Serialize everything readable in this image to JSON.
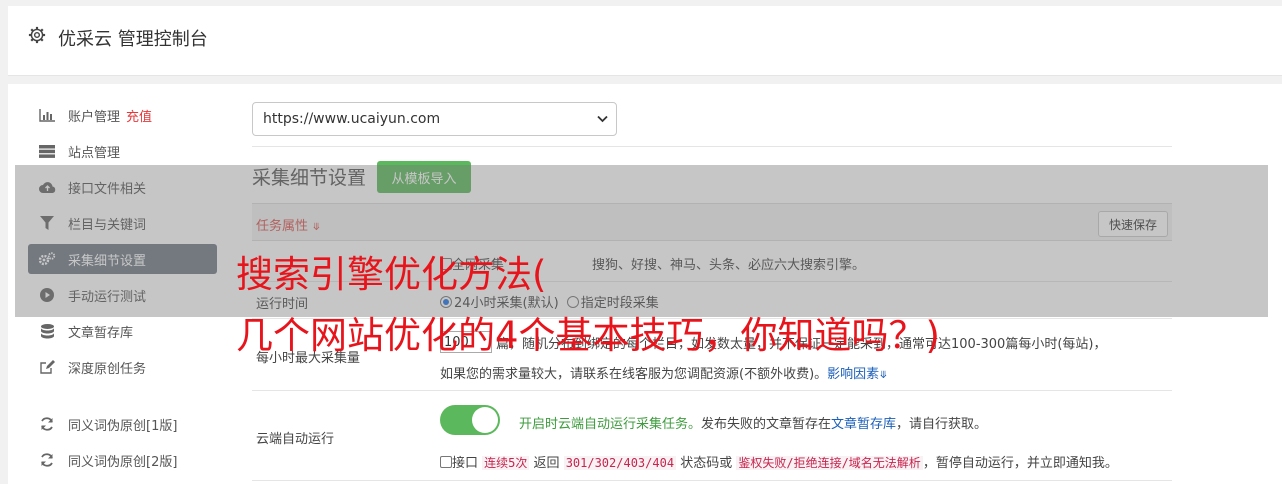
{
  "header": {
    "title": "优采云 管理控制台"
  },
  "sidebar": {
    "items": [
      {
        "label": "账户管理",
        "badge": "充值",
        "icon": "bar-chart-icon"
      },
      {
        "label": "站点管理",
        "icon": "server-icon"
      },
      {
        "label": "接口文件相关",
        "icon": "cloud-upload-icon"
      },
      {
        "label": "栏目与关键词",
        "icon": "filter-icon"
      },
      {
        "label": "采集细节设置",
        "icon": "cogs-icon",
        "active": true
      },
      {
        "label": "手动运行测试",
        "icon": "play-circle-icon"
      },
      {
        "label": "文章暂存库",
        "icon": "database-icon"
      },
      {
        "label": "深度原创任务",
        "icon": "edit-icon"
      },
      {
        "label": "同义词伪原创[1版]",
        "icon": "refresh-icon"
      },
      {
        "label": "同义词伪原创[2版]",
        "icon": "refresh-icon"
      }
    ]
  },
  "site_select": {
    "value": "https://www.ucaiyun.com"
  },
  "section": {
    "title": "采集细节设置",
    "import_button": "从模板导入"
  },
  "task_bar": {
    "label": "任务属性",
    "save_button": "快速保存"
  },
  "search_engines": {
    "checkbox_label": "全网采集",
    "suffix": "搜狗、好搜、神马、头条、必应六大搜索引擎。"
  },
  "run_time": {
    "label": "运行时间",
    "option1": "24小时采集(默认)",
    "option2": "指定时段采集"
  },
  "max_per_hour": {
    "label": "每小时最大采集量",
    "value": "100",
    "line1": "篇，随机分布到绑定的每个栏目，如发数太量，并不保证一定能采到，通常可达100-300篇每小时(每站)，",
    "line2": "如果您的需求量较大，请联系在线客服为您调配资源(不额外收费)。",
    "link": "影响因素"
  },
  "cloud_run": {
    "label": "云端自动运行",
    "enabled": true,
    "msg_green": "开启时云端自动运行采集任务。",
    "msg_mid": "发布失败的文章暂存在",
    "msg_link": "文章暂存库",
    "msg_end": "，请自行获取。",
    "cb_prefix": "接口",
    "code1": "连续5次",
    "mid1": "返回",
    "code2": "301/302/403/404",
    "mid2": "状态码或",
    "code3": "鉴权失败/拒绝连接/域名无法解析",
    "end": "，暂停自动运行，并立即通知我。"
  },
  "watermark": {
    "line1": "搜索引擎优化方法(",
    "line2": "几个网站优化的4个基本技巧，你知道吗？)"
  },
  "colors": {
    "accent_green": "#5cb85c",
    "active_sidebar": "#737b87",
    "watermark_red": "#e8141c"
  }
}
